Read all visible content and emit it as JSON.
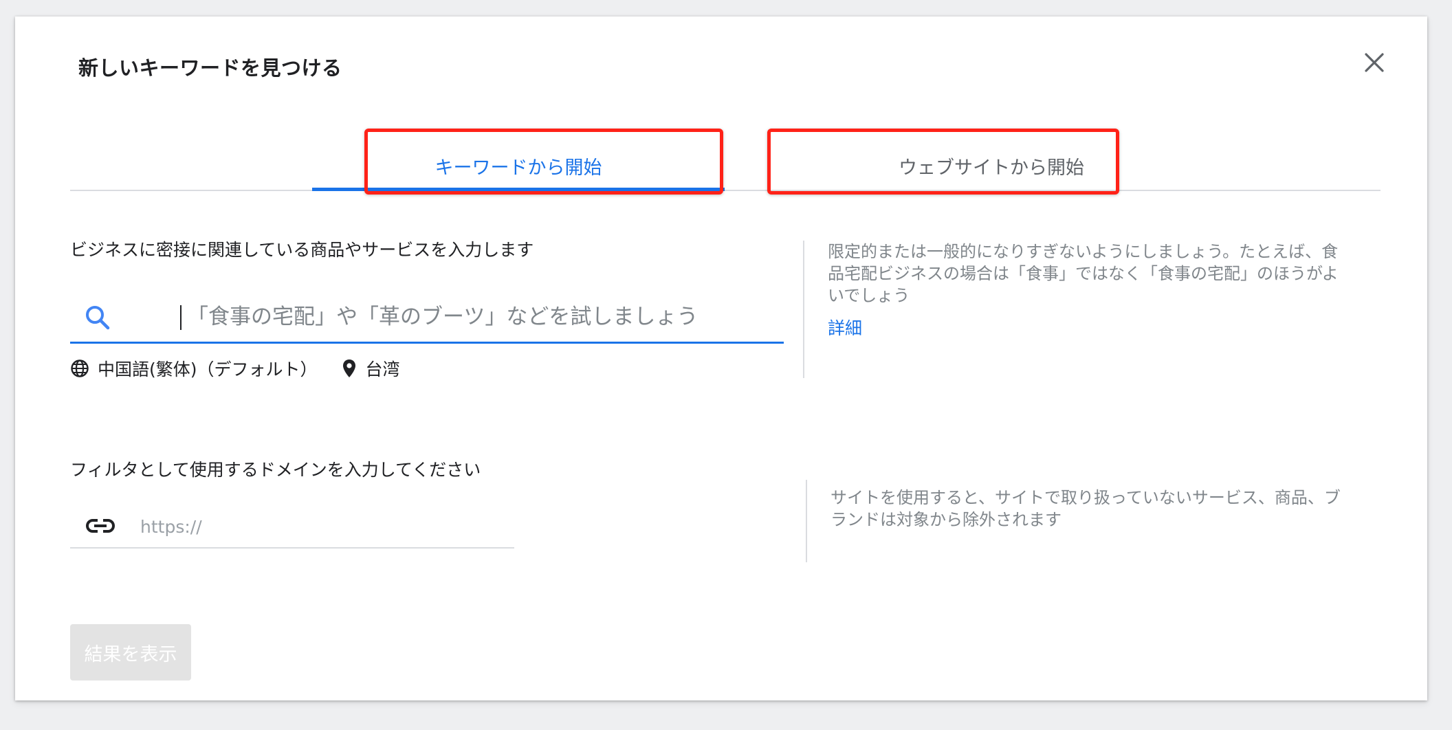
{
  "dialog": {
    "title": "新しいキーワードを見つける",
    "close_icon": "close-icon"
  },
  "tabs": [
    {
      "label": "キーワードから開始",
      "active": true
    },
    {
      "label": "ウェブサイトから開始",
      "active": false
    }
  ],
  "keyword_section": {
    "label": "ビジネスに密接に関連している商品やサービスを入力します",
    "input_placeholder": "「食事の宅配」や「革のブーツ」などを試しましょう",
    "input_value": "",
    "search_icon": "search-icon",
    "language_icon": "globe-icon",
    "language": "中国語(繁体)（デフォルト）",
    "location_icon": "location-pin-icon",
    "location": "台湾",
    "help_text": "限定的または一般的になりすぎないようにしましょう。たとえば、食品宅配ビジネスの場合は「食事」ではなく「食事の宅配」のほうがよいでしょう",
    "help_link": "詳細"
  },
  "domain_section": {
    "label": "フィルタとして使用するドメインを入力してください",
    "link_icon": "link-icon",
    "input_placeholder": "https://",
    "input_value": "",
    "help_text": "サイトを使用すると、サイトで取り扱っていないサービス、商品、ブランドは対象から除外されます"
  },
  "submit": {
    "label": "結果を表示",
    "enabled": false
  },
  "colors": {
    "accent": "#1a73e8",
    "highlight": "#ff2218",
    "disabled_button": "#e3e3e3"
  }
}
